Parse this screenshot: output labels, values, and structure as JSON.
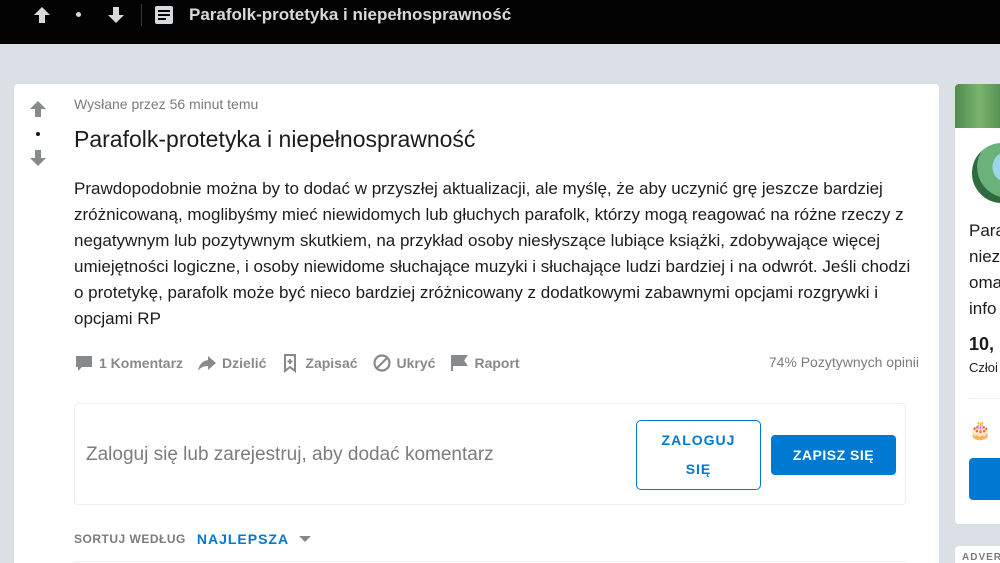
{
  "header": {
    "title": "Parafolk-protetyka i niepełnosprawność"
  },
  "post": {
    "posted_by": "Wysłane przez 56 minut temu",
    "title": "Parafolk-protetyka i niepełnosprawność",
    "body": "Prawdopodobnie można by to dodać w przyszłej aktualizacji, ale myślę, że aby uczynić grę jeszcze bardziej zróżnicowaną, moglibyśmy mieć niewidomych lub głuchych parafolk, którzy mogą reagować na różne rzeczy z negatywnym lub pozytywnym skutkiem, na przykład osoby niesłyszące lubiące książki, zdobywające więcej umiejętności logiczne, i osoby niewidome słuchające muzyki i słuchające ludzi bardziej i na odwrót. Jeśli chodzi o protetykę, parafolk może być nieco bardziej zróżnicowany z dodatkowymi zabawnymi opcjami rozgrywki i opcjami RP",
    "upvote_ratio": "74% Pozytywnych opinii"
  },
  "actions": {
    "comments": "1 Komentarz",
    "share": "Dzielić",
    "save": "Zapisać",
    "hide": "Ukryć",
    "report": "Raport"
  },
  "comment_box": {
    "prompt": "Zaloguj się lub zarejestruj, aby dodać komentarz",
    "login_line1": "ZALOGUJ",
    "login_line2": "SIĘ",
    "signup": "ZAPISZ SIĘ"
  },
  "sort": {
    "label": "SORTUJ WEDŁUG",
    "value": "NAJLEPSZA"
  },
  "sidebar": {
    "text_lines": [
      "Para",
      "niez",
      "oma",
      "info"
    ],
    "members_count": "10,",
    "members_label": "Człoi",
    "ad_label": "ADVER"
  },
  "colors": {
    "accent": "#0079d3",
    "background": "#dae0e6",
    "topbar": "#030303",
    "icon_gray": "#878a8c"
  }
}
